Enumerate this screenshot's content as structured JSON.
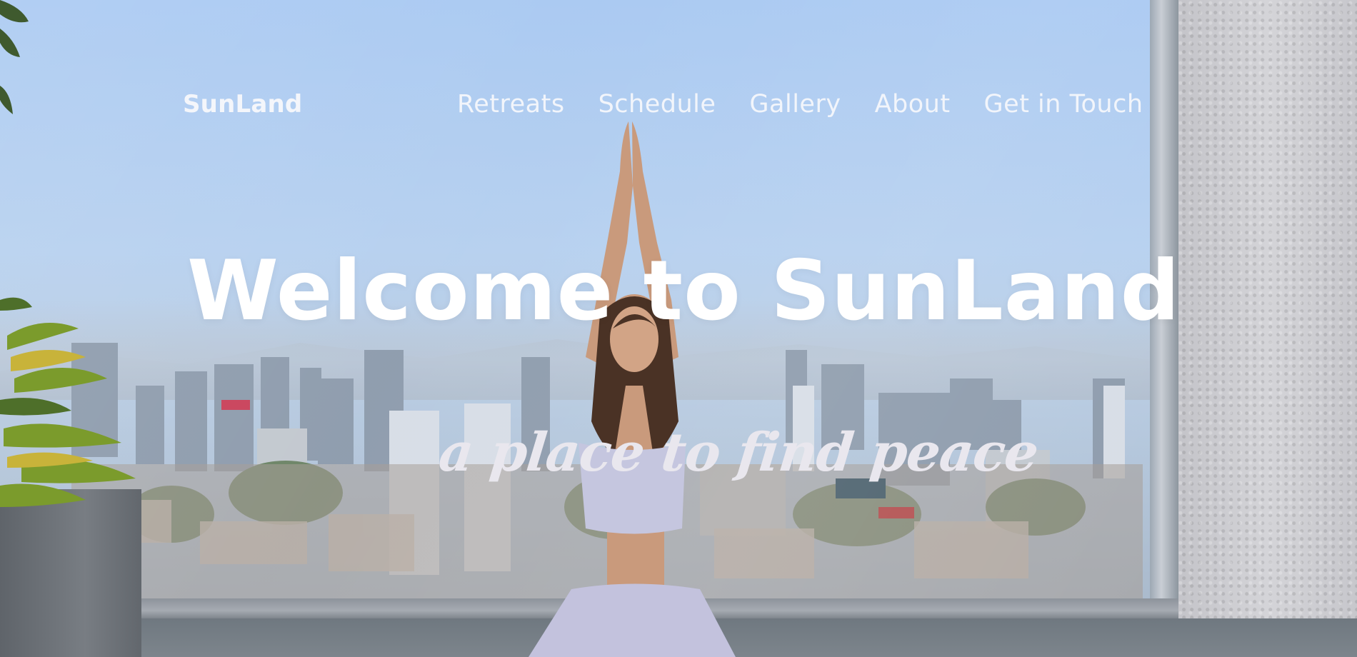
{
  "nav": {
    "brand": "SunLand",
    "links": [
      {
        "label": "Retreats"
      },
      {
        "label": "Schedule"
      },
      {
        "label": "Gallery"
      },
      {
        "label": "About"
      },
      {
        "label": "Get in Touch"
      }
    ]
  },
  "hero": {
    "title": "Welcome to SunLand",
    "tagline": "a place to find peace"
  },
  "colors": {
    "text_primary": "#ffffff",
    "tagline": "#e9e7ee",
    "sky": "#a9c9f2"
  }
}
